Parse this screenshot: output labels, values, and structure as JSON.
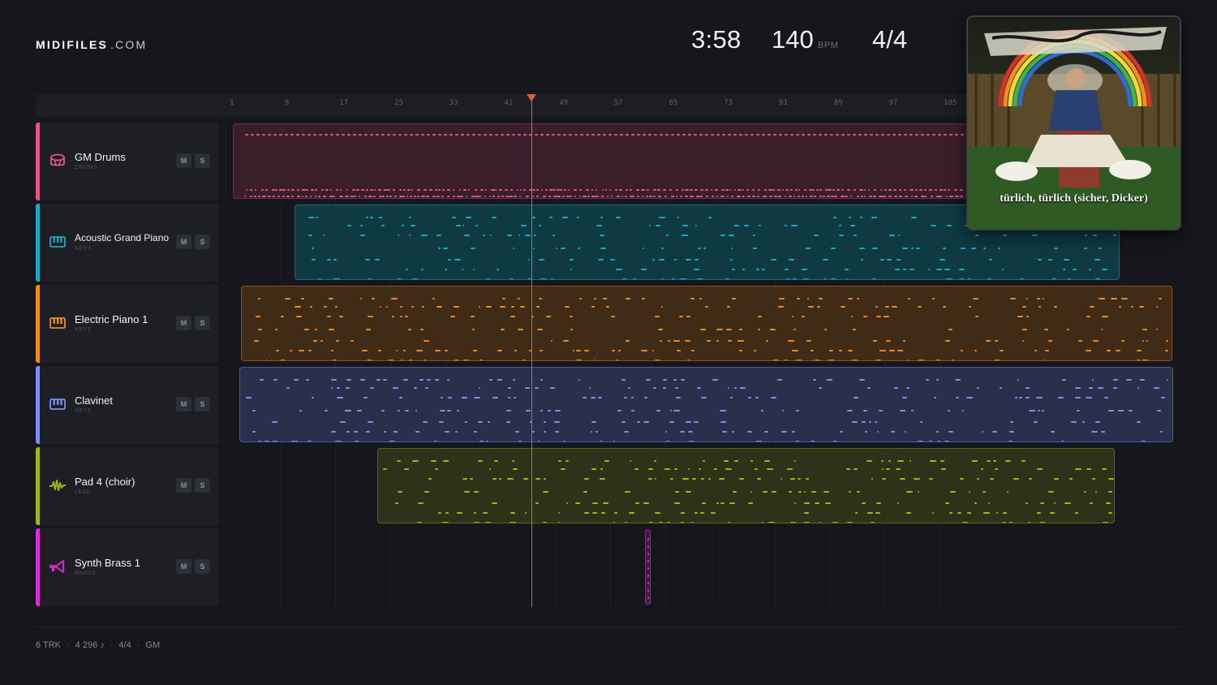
{
  "header": {
    "logo_bold": "MIDIFILES",
    "logo_suffix": ".COM",
    "time": "3:58",
    "bpm": "140",
    "bpm_label": "BPM",
    "signature": "4/4"
  },
  "ruler": {
    "bars": [
      "1",
      "9",
      "17",
      "25",
      "33",
      "41",
      "49",
      "57",
      "65",
      "73",
      "81",
      "89",
      "97",
      "105"
    ],
    "playhead_bar": 44
  },
  "tracks": [
    {
      "name": "GM Drums",
      "category": "DRUMS",
      "color": "#e2577f",
      "icon": "drum-icon",
      "mute": "M",
      "solo": "S"
    },
    {
      "name": "Acoustic Grand Piano",
      "category": "KEYS",
      "color": "#19a9c2",
      "icon": "piano-keys-icon",
      "mute": "M",
      "solo": "S"
    },
    {
      "name": "Electric Piano 1",
      "category": "KEYS",
      "color": "#ef8a1f",
      "icon": "piano-keys-icon",
      "mute": "M",
      "solo": "S"
    },
    {
      "name": "Clavinet",
      "category": "KEYS",
      "color": "#7b8ff0",
      "icon": "piano-keys-icon",
      "mute": "M",
      "solo": "S"
    },
    {
      "name": "Pad 4 (choir)",
      "category": "LEAD",
      "color": "#a3b51b",
      "icon": "waveform-icon",
      "mute": "M",
      "solo": "S"
    },
    {
      "name": "Synth Brass 1",
      "category": "BRASS",
      "color": "#df2bd6",
      "icon": "trumpet-icon",
      "mute": "M",
      "solo": "S"
    }
  ],
  "album": {
    "caption": "türlich, türlich (sicher, Dicker)"
  },
  "footer": {
    "tracks": "6 TRK",
    "notes": "4 296 ♪",
    "signature": "4/4",
    "standard": "GM"
  }
}
